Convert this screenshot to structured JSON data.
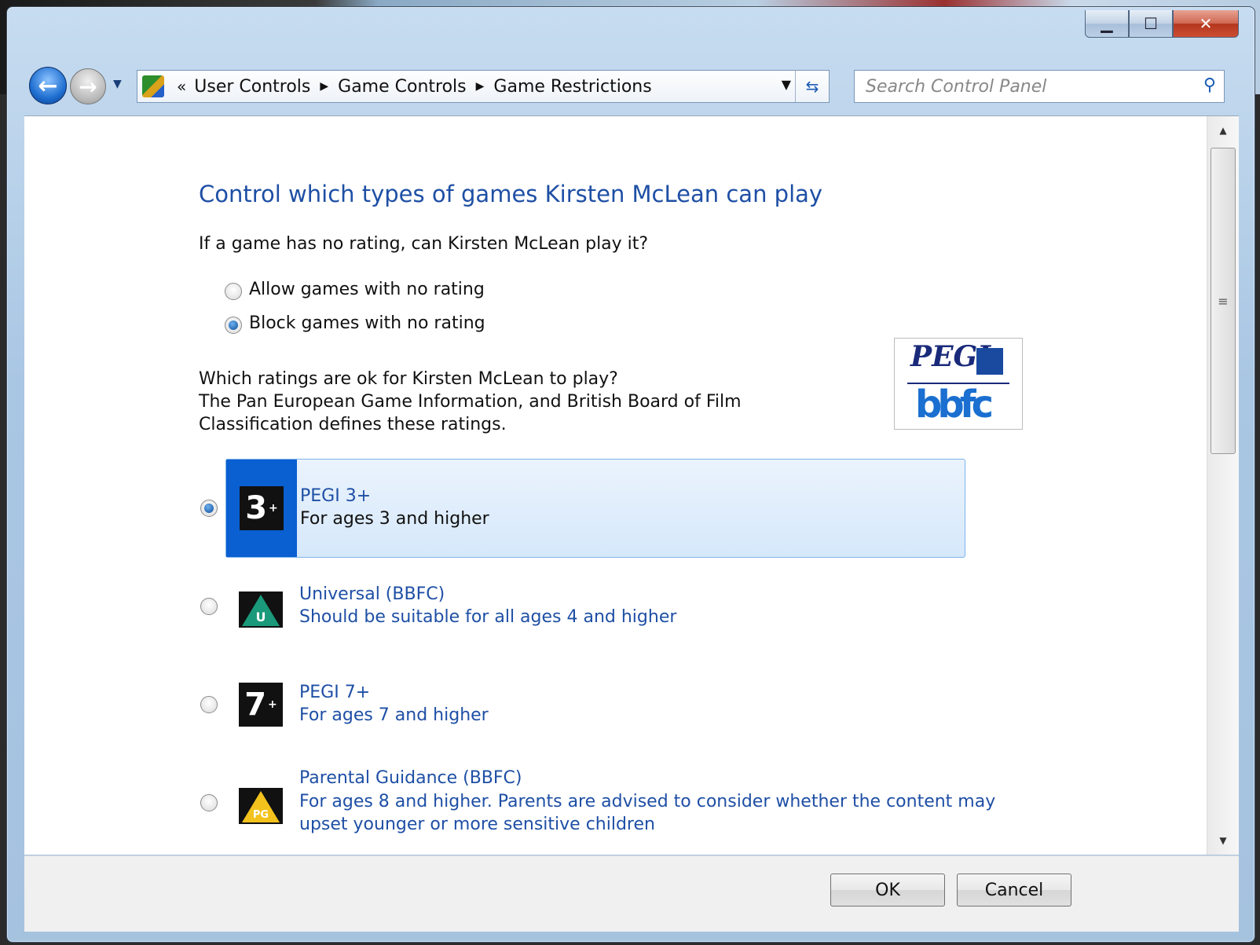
{
  "window": {
    "controls": {
      "minimize": "▁",
      "maximize": "☐",
      "close": "✕"
    }
  },
  "nav": {
    "back_glyph": "←",
    "forward_glyph": "→",
    "breadcrumb_prefix": "«",
    "breadcrumb": [
      "User Controls",
      "Game Controls",
      "Game Restrictions"
    ],
    "search_placeholder": "Search Control Panel"
  },
  "page": {
    "title": "Control which types of games Kirsten McLean can play",
    "unrated_question": "If a game has no rating, can Kirsten McLean play it?",
    "unrated_options": [
      {
        "label": "Allow games with no rating",
        "selected": false
      },
      {
        "label": "Block games with no rating",
        "selected": true
      }
    ],
    "ratings_question_line1": "Which ratings are ok for Kirsten McLean to play?",
    "ratings_question_line2": "The Pan European Game Information, and British Board of Film",
    "ratings_question_line3": "Classification defines these ratings.",
    "logo": {
      "pegi": "PEGI",
      "bbfc": "bbfc"
    },
    "ratings": [
      {
        "title": "PEGI 3+",
        "desc": "For ages 3 and higher",
        "badge": "3",
        "selected": true
      },
      {
        "title": "Universal (BBFC)",
        "desc": "Should be suitable for all ages 4 and higher",
        "badge": "U",
        "selected": false
      },
      {
        "title": "PEGI 7+",
        "desc": "For ages 7 and higher",
        "badge": "7",
        "selected": false
      },
      {
        "title": "Parental Guidance (BBFC)",
        "desc": "For ages 8 and higher. Parents are advised to consider whether the content may upset younger or more sensitive children",
        "badge": "PG",
        "selected": false
      }
    ]
  },
  "footer": {
    "ok": "OK",
    "cancel": "Cancel"
  },
  "colors": {
    "link_blue": "#1e4fa5",
    "selected_bar": "#0a5fd1",
    "selected_bg": "#d6e8fb"
  }
}
